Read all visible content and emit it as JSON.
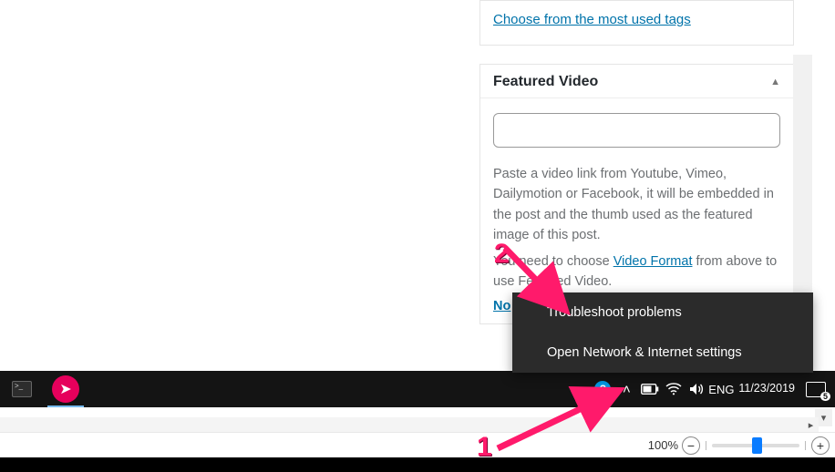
{
  "tags_panel": {
    "link_label": "Choose from the most used tags"
  },
  "featured_video": {
    "title": "Featured Video",
    "input_value": "",
    "desc_before": "Paste a video link from Youtube, Vimeo, Dailymotion or Facebook, it will be embedded in the post and the thumb used as the featured image of this post.",
    "desc_need_before": "You need to choose ",
    "desc_need_link": "Video Format",
    "desc_need_after": " from above to use Featured Video.",
    "notice": "No"
  },
  "context_menu": {
    "items": [
      "Troubleshoot problems",
      "Open Network & Internet settings"
    ]
  },
  "taskbar": {
    "language": "ENG",
    "date": "11/23/2019",
    "notif_count": "5",
    "icons": {
      "terminal": "terminal-icon",
      "app": "app-icon",
      "help": "help-icon",
      "chevron": "chevron-up-icon",
      "battery": "battery-icon",
      "wifi": "wifi-icon",
      "speaker": "speaker-icon",
      "notifications": "notifications-icon"
    }
  },
  "zoom": {
    "level": "100%"
  },
  "annotations": {
    "one": "1",
    "two": "2"
  }
}
